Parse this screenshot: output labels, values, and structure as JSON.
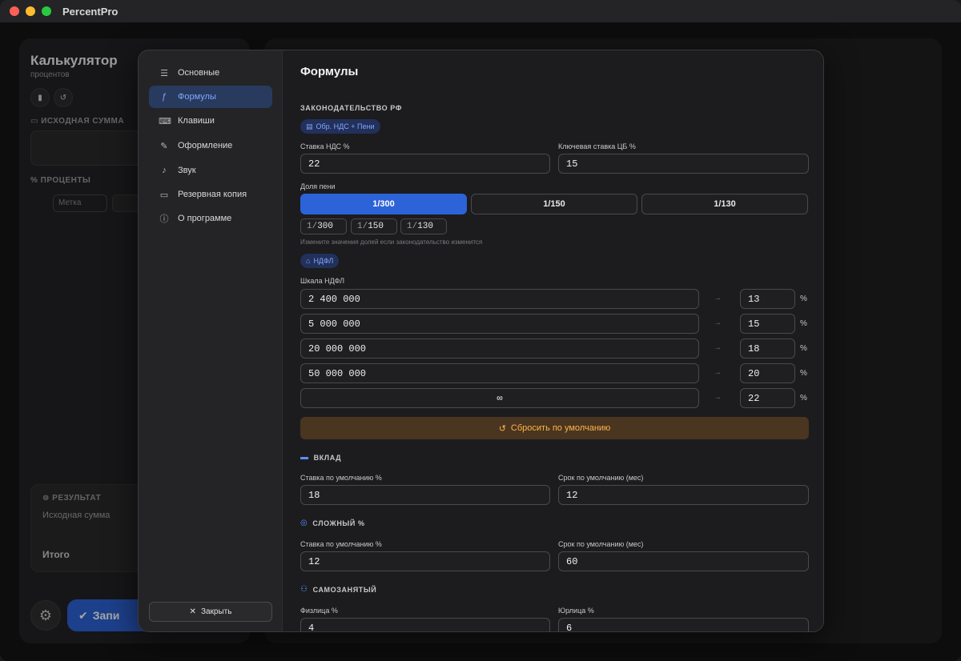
{
  "app": {
    "title": "PercentPro"
  },
  "background": {
    "calc_title": "Калькулятор",
    "calc_subtitle": "процентов",
    "source_sum_section": "ИСХОДНАЯ СУММА",
    "percents_section": "ПРОЦЕНТЫ",
    "label_placeholder": "Метка",
    "result_section": "РЕЗУЛЬТАТ",
    "result_source": "Исходная сумма",
    "result_total": "Итого",
    "write_button": "Запи"
  },
  "sidebar": {
    "items": [
      {
        "label": "Основные",
        "icon": "sliders-icon"
      },
      {
        "label": "Формулы",
        "icon": "function-icon",
        "active": true
      },
      {
        "label": "Клавиши",
        "icon": "keyboard-icon"
      },
      {
        "label": "Оформление",
        "icon": "brush-icon"
      },
      {
        "label": "Звук",
        "icon": "speaker-icon"
      },
      {
        "label": "Резервная копия",
        "icon": "drive-icon"
      },
      {
        "label": "О программе",
        "icon": "info-icon"
      }
    ],
    "close_label": "Закрыть"
  },
  "formulas": {
    "title": "Формулы",
    "law_section": "ЗАКОНОДАТЕЛЬСТВО РФ",
    "vat_chip": "Обр. НДС + Пени",
    "vat_rate_label": "Ставка НДС %",
    "vat_rate_value": "22",
    "key_rate_label": "Ключевая ставка ЦБ %",
    "key_rate_value": "15",
    "penalty_label": "Доля пени",
    "penalty_options": [
      "1/300",
      "1/150",
      "1/130"
    ],
    "penalty_selected": "1/300",
    "penalty_prefix": "1/",
    "penalty_denoms": [
      "300",
      "150",
      "130"
    ],
    "penalty_hint": "Измените значения долей если законодательство изменится",
    "ndfl_chip": "НДФЛ",
    "ndfl_scale_label": "Шкала НДФЛ",
    "ndfl_rows": [
      {
        "threshold": "2 400 000",
        "rate": "13"
      },
      {
        "threshold": "5 000 000",
        "rate": "15"
      },
      {
        "threshold": "20 000 000",
        "rate": "18"
      },
      {
        "threshold": "50 000 000",
        "rate": "20"
      },
      {
        "threshold": "∞",
        "rate": "22"
      }
    ],
    "percent_sign": "%",
    "reset_label": "Сбросить по умолчанию",
    "deposit_section": "ВКЛАД",
    "deposit_rate_label": "Ставка по умолчанию %",
    "deposit_rate_value": "18",
    "deposit_term_label": "Срок по умолчанию (мес)",
    "deposit_term_value": "12",
    "compound_section": "СЛОЖНЫЙ %",
    "compound_rate_label": "Ставка по умолчанию %",
    "compound_rate_value": "12",
    "compound_term_label": "Срок по умолчанию (мес)",
    "compound_term_value": "60",
    "selfemployed_section": "САМОЗАНЯТЫЙ",
    "individual_label": "Физлица %",
    "individual_value": "4",
    "legal_label": "Юрлица %",
    "legal_value": "6"
  }
}
